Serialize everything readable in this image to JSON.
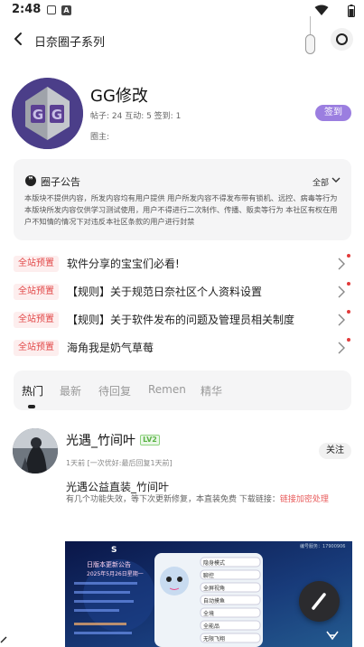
{
  "status": {
    "time": "2:48",
    "notif_letter": "A"
  },
  "header": {
    "title": "日奈圈子系列"
  },
  "circle": {
    "name": "GG修改",
    "logo_text": "GG",
    "stats": "帖子: 24 互动: 5 签到: 1",
    "owner": "圈主:",
    "signin_label": "签到"
  },
  "notice": {
    "title": "圈子公告",
    "all_label": "全部",
    "text": "本版块不提供内容，所发内容均有用户提供 用户所发内容不得发布带有锁机、远控、病毒等行为 本版块所发内容仅供学习测试使用，用户不得进行二次制作、传播、贩卖等行为 本社区有权在用户不知情的情况下对违反本社区条款的用户进行封禁"
  },
  "pinned": [
    {
      "tag": "全站预置",
      "text": "软件分享的宝宝们必看!"
    },
    {
      "tag": "全站预置",
      "text": "【规则】关于规范日奈社区个人资料设置"
    },
    {
      "tag": "全站预置",
      "text": "【规则】关于软件发布的问题及管理员相关制度"
    },
    {
      "tag": "全站预置",
      "text": "海角我是奶气草莓"
    }
  ],
  "tabs": [
    "热门",
    "最新",
    "待回复",
    "Remen",
    "精华"
  ],
  "post": {
    "author": "光遇_竹间叶",
    "level": "LV2",
    "follow_label": "关注",
    "meta": "1天前 [一次优好:最后回复1天前]",
    "title": "光遇公益直装_竹间叶",
    "body": "有几个功能失效，等下次更新修复，本直装免费 下载链接：",
    "link": "链接加密处理"
  },
  "screenshot": {
    "heading": "日版本更新公告",
    "date": "2025年5月26日星期一",
    "menu": [
      "隐身模式",
      "聊控",
      "全屏视角",
      "自动摸鱼",
      "全境",
      "全能品",
      "无限飞翔"
    ],
    "top_right": "编号服务：17900906"
  },
  "colors": {
    "accent": "#9b7ee0",
    "pin_tag": "#e24a4a",
    "link": "#e85b5b"
  }
}
